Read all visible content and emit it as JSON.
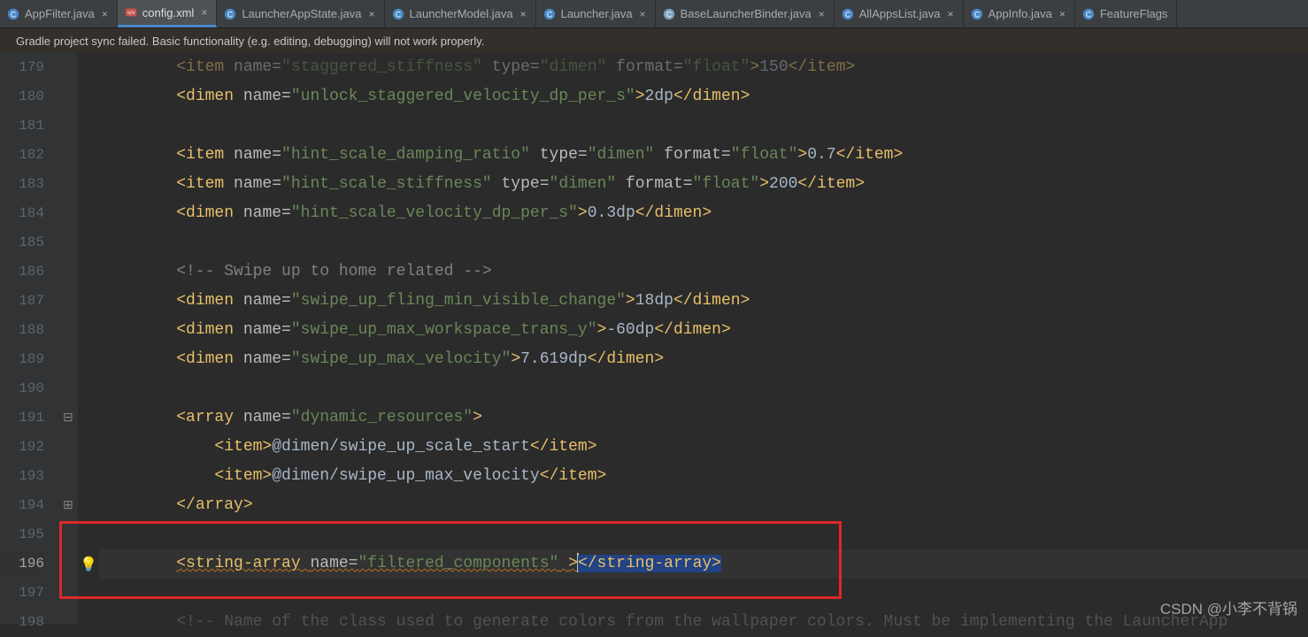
{
  "tabs": [
    {
      "label": "AppFilter.java",
      "icon": "class",
      "active": false
    },
    {
      "label": "config.xml",
      "icon": "xml",
      "active": true
    },
    {
      "label": "LauncherAppState.java",
      "icon": "class",
      "active": false
    },
    {
      "label": "LauncherModel.java",
      "icon": "class",
      "active": false
    },
    {
      "label": "Launcher.java",
      "icon": "class",
      "active": false
    },
    {
      "label": "BaseLauncherBinder.java",
      "icon": "class_g",
      "active": false
    },
    {
      "label": "AllAppsList.java",
      "icon": "class",
      "active": false
    },
    {
      "label": "AppInfo.java",
      "icon": "class",
      "active": false
    },
    {
      "label": "FeatureFlags",
      "icon": "class",
      "active": false,
      "nocross": true
    }
  ],
  "infobar": {
    "text": "Gradle project sync failed. Basic functionality (e.g. editing, debugging) will not work properly."
  },
  "lines": {
    "start": 179,
    "count": 20,
    "content": [
      {
        "n": 179,
        "kind": "xml_item",
        "tag": "item",
        "attrs": [
          [
            "name",
            "staggered_stiffness"
          ],
          [
            "type",
            "dimen"
          ],
          [
            "format",
            "float"
          ]
        ],
        "text": "150",
        "faded": true
      },
      {
        "n": 180,
        "kind": "xml_item",
        "tag": "dimen",
        "attrs": [
          [
            "name",
            "unlock_staggered_velocity_dp_per_s"
          ]
        ],
        "text": "2dp"
      },
      {
        "n": 181,
        "kind": "blank"
      },
      {
        "n": 182,
        "kind": "xml_item",
        "tag": "item",
        "attrs": [
          [
            "name",
            "hint_scale_damping_ratio"
          ],
          [
            "type",
            "dimen"
          ],
          [
            "format",
            "float"
          ]
        ],
        "text": "0.7"
      },
      {
        "n": 183,
        "kind": "xml_item",
        "tag": "item",
        "attrs": [
          [
            "name",
            "hint_scale_stiffness"
          ],
          [
            "type",
            "dimen"
          ],
          [
            "format",
            "float"
          ]
        ],
        "text": "200"
      },
      {
        "n": 184,
        "kind": "xml_item",
        "tag": "dimen",
        "attrs": [
          [
            "name",
            "hint_scale_velocity_dp_per_s"
          ]
        ],
        "text": "0.3dp"
      },
      {
        "n": 185,
        "kind": "blank"
      },
      {
        "n": 186,
        "kind": "comment",
        "text": "<!-- Swipe up to home related -->"
      },
      {
        "n": 187,
        "kind": "xml_item",
        "tag": "dimen",
        "attrs": [
          [
            "name",
            "swipe_up_fling_min_visible_change"
          ]
        ],
        "text": "18dp"
      },
      {
        "n": 188,
        "kind": "xml_item",
        "tag": "dimen",
        "attrs": [
          [
            "name",
            "swipe_up_max_workspace_trans_y"
          ]
        ],
        "text": "-60dp"
      },
      {
        "n": 189,
        "kind": "xml_item",
        "tag": "dimen",
        "attrs": [
          [
            "name",
            "swipe_up_max_velocity"
          ]
        ],
        "text": "7.619dp"
      },
      {
        "n": 190,
        "kind": "blank"
      },
      {
        "n": 191,
        "kind": "open",
        "tag": "array",
        "attrs": [
          [
            "name",
            "dynamic_resources"
          ]
        ],
        "fold": "down"
      },
      {
        "n": 192,
        "kind": "xml_item",
        "tag": "item",
        "attrs": [],
        "text": "@dimen/swipe_up_scale_start",
        "indent": 2
      },
      {
        "n": 193,
        "kind": "xml_item",
        "tag": "item",
        "attrs": [],
        "text": "@dimen/swipe_up_max_velocity",
        "indent": 2
      },
      {
        "n": 194,
        "kind": "close",
        "tag": "array",
        "fold": "up"
      },
      {
        "n": 195,
        "kind": "blank"
      },
      {
        "n": 196,
        "kind": "current",
        "tag": "string-array",
        "attrs": [
          [
            "name",
            "filtered_components"
          ]
        ],
        "bulb": true
      },
      {
        "n": 197,
        "kind": "blank"
      },
      {
        "n": 198,
        "kind": "comment",
        "text": "<!-- Name of the class used to generate colors from the wallpaper colors. Must be implementing the LauncherApp",
        "faded": true
      }
    ]
  },
  "watermark": "CSDN @小李不背锅"
}
